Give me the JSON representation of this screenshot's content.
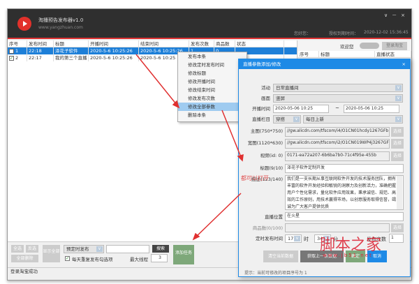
{
  "app": {
    "title": "淘播预告发布器v1.0",
    "site": "www.yangzhuan.com",
    "controls": [
      "∨",
      "－",
      "×"
    ],
    "account_label": "您好您：",
    "expire_label": "授权到期时间：",
    "expire_value": "2020-12-02 15:36:45"
  },
  "table": {
    "headers": [
      "序号",
      "发布时间",
      "标题",
      "开播时间",
      "结束时间",
      "发布次数",
      "商品数",
      "状态"
    ],
    "rows": [
      {
        "checked": false,
        "selected": true,
        "cells": [
          "1",
          "22:18",
          "泽花子软件",
          "2020-5-6 10:25:26",
          "2020-5-6 10:25:26",
          "1",
          "0",
          ""
        ]
      },
      {
        "checked": true,
        "selected": false,
        "cells": [
          "2",
          "22:17",
          "我的第三个直播",
          "2020-5-6 10:25:26",
          "2020-5-6 10:25",
          "",
          " ",
          ""
        ]
      }
    ]
  },
  "right_panel": {
    "welcome": "欢迎您",
    "login_button": "登录淘宝",
    "headers": [
      "序号",
      "标题",
      "直播状态"
    ]
  },
  "context_menu": {
    "items": [
      "发布本条",
      "修改定时发布时间",
      "修改标题",
      "修改开播时间",
      "修改结束时间",
      "修改发布次数",
      "修改全部参数",
      "删除本条"
    ],
    "highlighted": 6
  },
  "dialog": {
    "title": "直播参数添加/修改",
    "close": "×",
    "activity_label": "活动",
    "activity": "日常直播间",
    "screen_label": "画面",
    "screen": "竖屏",
    "start_label": "开播时间",
    "start": "2020-05-06 10:25",
    "dash": "~",
    "end": "2020-05-06 10:25",
    "column_label": "直播栏目",
    "column1": "穿搭",
    "column2": "每日上新",
    "main_img_label": "主图(750*750)",
    "main_img": "//gw.alicdn.com/tfscom/i4/O1CN01hcdy1267GFb",
    "wide_img_label": "宽图(1120*630)",
    "wide_img": "//gw.alicdn.com/tfscom/i2/O1CN019WP4j3267GFC",
    "video_label": "视频(id: 0)",
    "video": "0171-ea72a207-6b6ba7b0-71c4f95e-455b",
    "choose": "选择",
    "title_label": "标题(9/10)",
    "title_value": "泽花子软件定制开发",
    "desc_label": "描述(123/140)",
    "desc": "我们是一支长期从事互联网软件开发的技术服务团队，拥有丰富的软件开发经验和敏锐的洞察力及创新活力，准确把握用户个性化需求，量化软件应用效果，秉承诚信、规范、高效的工作原则，用技术赢得市场，以创意服务取得信誉，竭诚为广大客户提供优质",
    "location_label": "直播位置",
    "location": "在火星",
    "goods_label": "商品数(0/100)",
    "goods": "",
    "timer_label": "定时发布时间",
    "hour": "17",
    "hour_unit": "时",
    "minute": "34",
    "minute_unit": "分",
    "count_label": "发布次数",
    "count": "1",
    "btn_clear": "清空当前数据",
    "btn_fetch": "获取上一条数据",
    "btn_ok": "确定",
    "btn_cancel": "取消",
    "hint": "提示：当前可修改的项目序号为 1"
  },
  "annotation": "都可以打开",
  "bottom": {
    "select_all": "全选",
    "invert": "反选",
    "delete_all": "全部删除",
    "show_all": "显示全部",
    "mode": "预定时发布",
    "search": "搜索",
    "checkbox_label": "每天重复发布勾选项",
    "checked": true,
    "threads_label": "最大线程",
    "threads": "3",
    "add_task": "添加任务"
  },
  "status": "登录淘宝成功",
  "watermark": {
    "text": "脚本之家",
    "url": "www.jb51.net"
  }
}
